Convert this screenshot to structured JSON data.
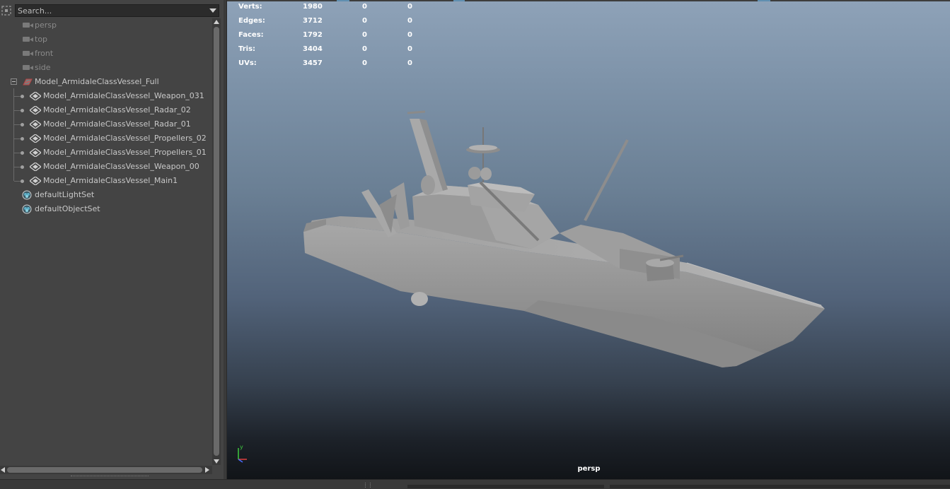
{
  "outliner": {
    "search_placeholder": "Search...",
    "cameras": [
      {
        "label": "persp"
      },
      {
        "label": "top"
      },
      {
        "label": "front"
      },
      {
        "label": "side"
      }
    ],
    "group": {
      "label": "Model_ArmidaleClassVessel_Full",
      "expanded": true
    },
    "children": [
      {
        "label": "Model_ArmidaleClassVessel_Weapon_031"
      },
      {
        "label": "Model_ArmidaleClassVessel_Radar_02"
      },
      {
        "label": "Model_ArmidaleClassVessel_Radar_01"
      },
      {
        "label": "Model_ArmidaleClassVessel_Propellers_02"
      },
      {
        "label": "Model_ArmidaleClassVessel_Propellers_01"
      },
      {
        "label": "Model_ArmidaleClassVessel_Weapon_00"
      },
      {
        "label": "Model_ArmidaleClassVessel_Main1"
      }
    ],
    "sets": [
      {
        "label": "defaultLightSet"
      },
      {
        "label": "defaultObjectSet"
      }
    ],
    "icons": {
      "camera": "camera-icon",
      "group": "group-icon",
      "mesh": "mesh-icon",
      "set": "set-icon",
      "search_options": "chevron-down-icon"
    }
  },
  "viewport": {
    "camera_name": "persp",
    "hud": [
      {
        "label": "Verts:",
        "values": [
          "1980",
          "0",
          "0"
        ]
      },
      {
        "label": "Edges:",
        "values": [
          "3712",
          "0",
          "0"
        ]
      },
      {
        "label": "Faces:",
        "values": [
          "1792",
          "0",
          "0"
        ]
      },
      {
        "label": "Tris:",
        "values": [
          "3404",
          "0",
          "0"
        ]
      },
      {
        "label": "UVs:",
        "values": [
          "3457",
          "0",
          "0"
        ]
      }
    ],
    "axis": {
      "y": "y",
      "x": "x",
      "z": "z"
    }
  },
  "colors": {
    "panel_bg": "#444444",
    "field_bg": "#2b2b2b",
    "viewport_top": "#8ea2b8",
    "viewport_bottom": "#111418",
    "accent": "#5f8fb0"
  }
}
